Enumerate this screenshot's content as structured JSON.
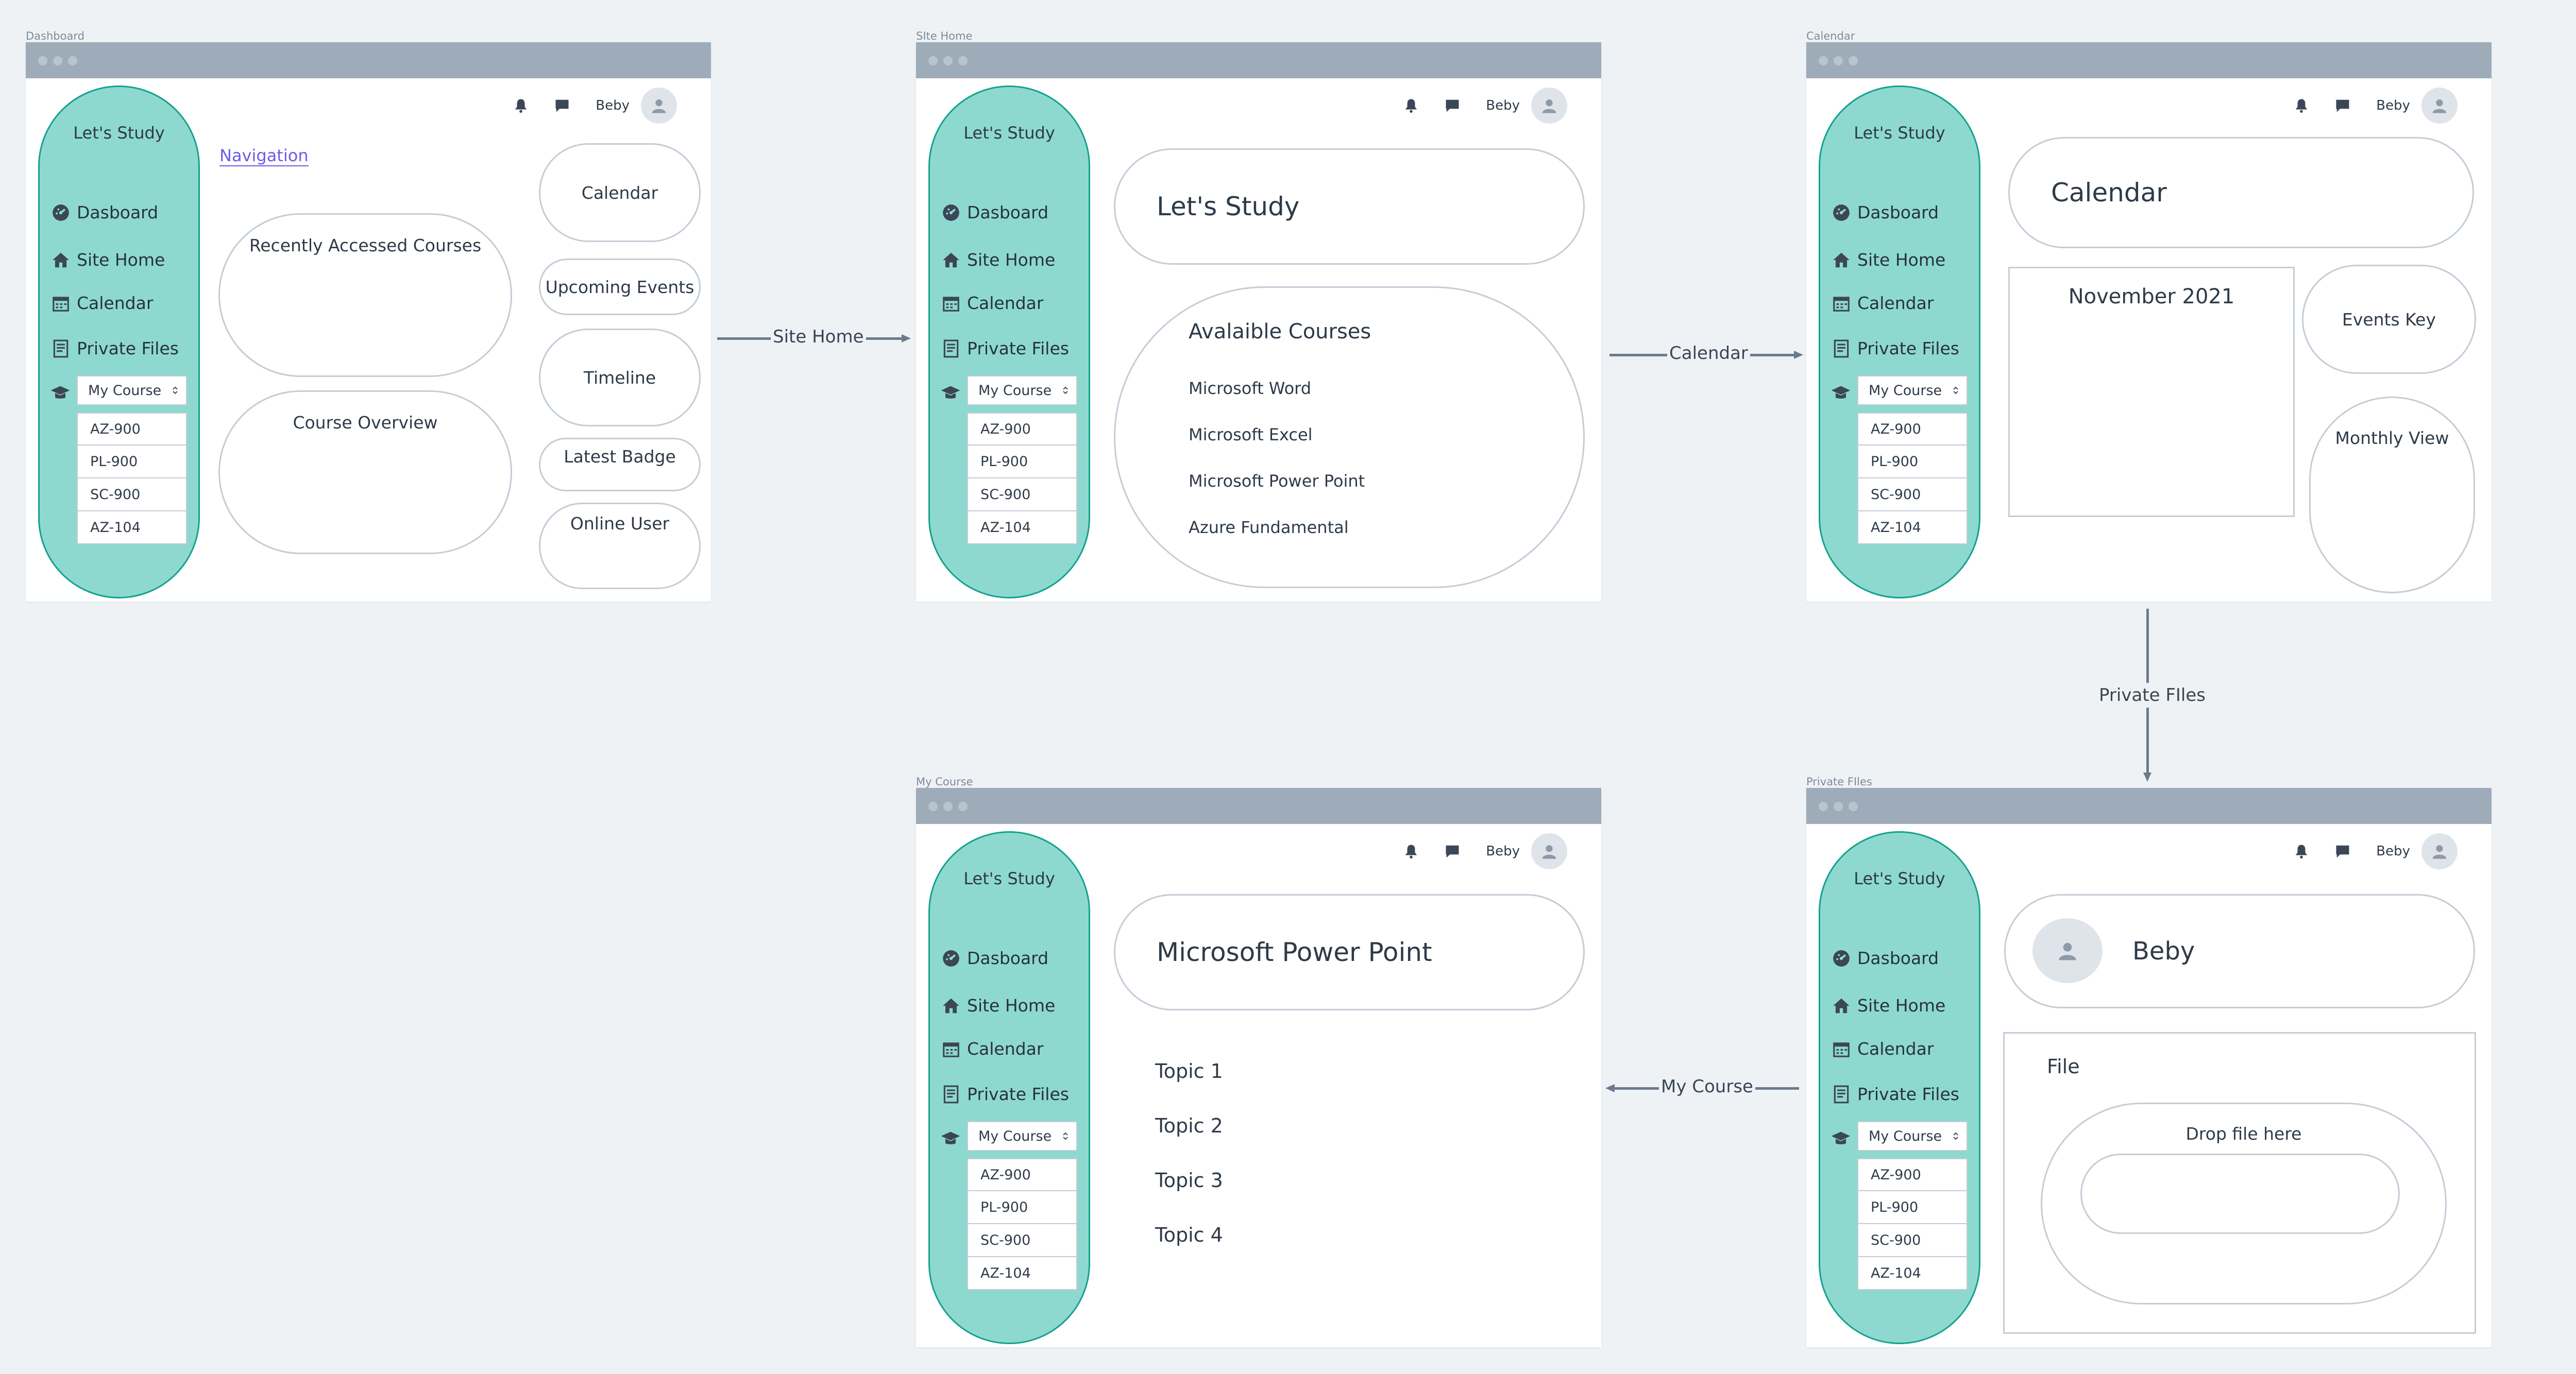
{
  "sidebar": {
    "title": "Let's Study",
    "items": [
      "Dasboard",
      "Site Home",
      "Calendar",
      "Private Files"
    ],
    "course_select": "My Course",
    "courses": [
      "AZ-900",
      "PL-900",
      "SC-900",
      "AZ-104"
    ]
  },
  "user": {
    "name": "Beby"
  },
  "frames": {
    "dashboard": {
      "label": "Dashboard",
      "nav_link": "Navigation",
      "recent": "Recently Accessed Courses",
      "overview": "Course Overview",
      "calendar": "Calendar",
      "events": "Upcoming Events",
      "timeline": "Timeline",
      "badge": "Latest Badge",
      "online": "Online User"
    },
    "sitehome": {
      "label": "SIte Home",
      "heading": "Let's Study",
      "courses_title": "Avalaible Courses",
      "courses": [
        "Microsoft Word",
        "Microsoft Excel",
        "Microsoft Power Point",
        "Azure Fundamental"
      ]
    },
    "calendar": {
      "label": "Calendar",
      "heading": "Calendar",
      "month": "November 2021",
      "events_key": "Events Key",
      "monthly": "Monthly View"
    },
    "mycourse": {
      "label": "My Course",
      "heading": "Microsoft Power Point",
      "topics": [
        "Topic 1",
        "Topic 2",
        "Topic 3",
        "Topic 4"
      ]
    },
    "privatefiles": {
      "label": "Private FIles",
      "profile_name": "Beby",
      "file_title": "File",
      "drop": "Drop file here"
    }
  },
  "arrows": {
    "sitehome": "Site Home",
    "calendar": "Calendar",
    "private": "Private FIles",
    "mycourse": "My Course"
  },
  "colors": {
    "background": "#eff2f5",
    "titlebar": "#9eacb9",
    "sidebar_fill": "#8ed9cf",
    "sidebar_border": "#14a28e",
    "link": "#6b5ce7",
    "connector": "#6b7b8c"
  }
}
